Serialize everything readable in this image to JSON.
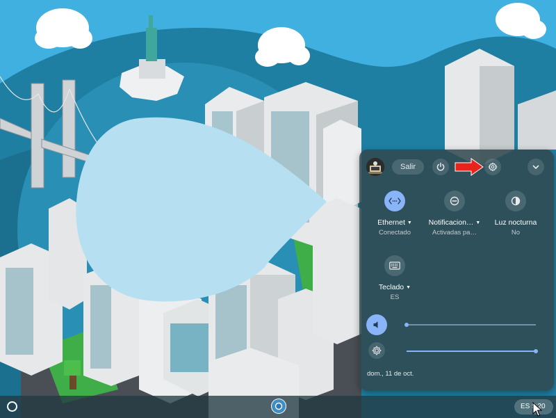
{
  "quick_settings": {
    "avatar_icon": "user-avatar-icon",
    "signout_label": "Salir",
    "power_icon": "power-icon",
    "settings_icon": "gear-icon",
    "collapse_icon": "chevron-down-icon",
    "tiles": [
      {
        "icon": "ethernet-icon",
        "label": "Ethernet",
        "status": "Conectado",
        "active": true
      },
      {
        "icon": "do-not-disturb-icon",
        "label": "Notificacion…",
        "status": "Activadas pa…",
        "active": false
      },
      {
        "icon": "night-light-icon",
        "label": "Luz nocturna",
        "status": "No",
        "active": false
      },
      {
        "icon": "keyboard-icon",
        "label": "Teclado",
        "status": "ES",
        "active": false
      }
    ],
    "volume": {
      "icon": "volume-icon",
      "level": 0.0
    },
    "brightness": {
      "icon": "brightness-icon",
      "level": 1.0
    },
    "date": "dom., 11 de oct."
  },
  "shelf": {
    "launcher_icon": "launcher-icon",
    "pinned_app_icon": "chrome-icon",
    "status_text": "ES 5:20"
  },
  "annotation": {
    "icon": "red-arrow-icon",
    "color": "#e8231c"
  },
  "colors": {
    "accent": "#8ab4f8",
    "panel": "#30484e",
    "sky": "#3fb0e0",
    "hills": "#1f7fa3"
  }
}
